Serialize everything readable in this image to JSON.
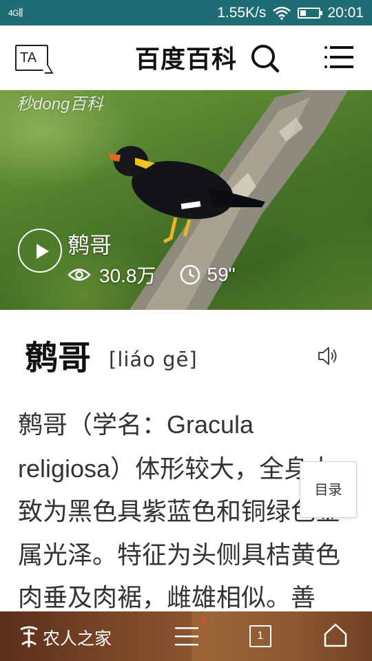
{
  "status_bar": {
    "signal": "4G",
    "speed": "1.55K/s",
    "time": "20:01"
  },
  "header": {
    "ta_label": "TA",
    "title": "百度百科"
  },
  "video": {
    "watermark": "秒dong百科",
    "title": "鹩哥",
    "views": "30.8万",
    "duration": "59\""
  },
  "entry": {
    "title": "鹩哥",
    "pinyin": "[liáo gē]",
    "body_segments": [
      {
        "text": "鹩哥（学名：",
        "latin": false
      },
      {
        "text": "Gracula religiosa",
        "latin": true
      },
      {
        "text": "）体形较大，全身大致为黑色具紫蓝色和铜绿色金属光泽。特征为头侧具桔黄色肉垂及肉裾，雌雄相似。善",
        "latin": false
      }
    ]
  },
  "toc": {
    "label": "目录"
  },
  "bottom_bar": {
    "brand": "农人之家",
    "tabs_count": "1"
  }
}
